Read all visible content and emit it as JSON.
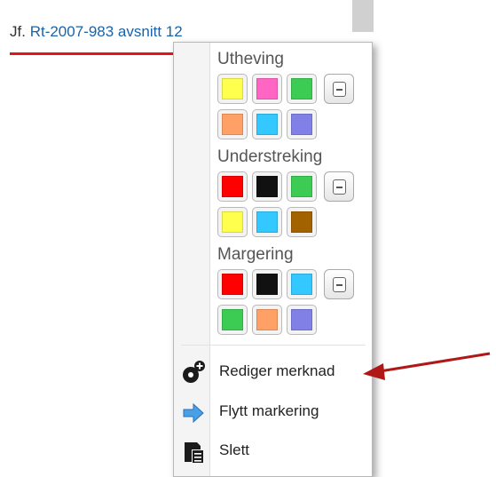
{
  "reference": {
    "prefix": "Jf.",
    "link": "Rt-2007-983 avsnitt 12"
  },
  "menu": {
    "sections": [
      {
        "label": "Utheving",
        "colors": [
          "#ffff4d",
          "#ff66c4",
          "#3ccc54",
          "#ffa066",
          "#33c8ff",
          "#8080e6"
        ]
      },
      {
        "label": "Understreking",
        "colors": [
          "#ff0000",
          "#111111",
          "#3ccc54",
          "#ffff4d",
          "#33c8ff",
          "#a36200"
        ]
      },
      {
        "label": "Margering",
        "colors": [
          "#ff0000",
          "#111111",
          "#33c8ff",
          "#3ccc54",
          "#ffa066",
          "#8080e6"
        ]
      }
    ],
    "actions": [
      {
        "label": "Rediger merknad",
        "icon": "edit-note-icon"
      },
      {
        "label": "Flytt markering",
        "icon": "move-arrow-icon"
      },
      {
        "label": "Slett",
        "icon": "delete-icon"
      }
    ]
  },
  "annotation": {
    "arrow_color": "#b01818"
  }
}
